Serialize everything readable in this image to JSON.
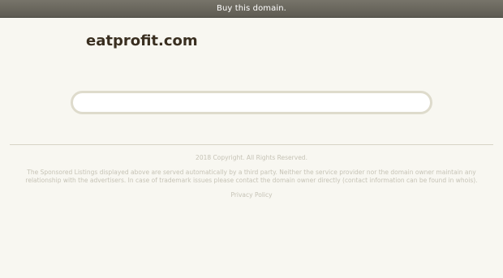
{
  "topbar": {
    "buy_label": "Buy this domain."
  },
  "header": {
    "domain": "eatprofit.com"
  },
  "search": {
    "value": "",
    "placeholder": ""
  },
  "footer": {
    "copyright": "2018 Copyright. All Rights Reserved.",
    "disclaimer": "The Sponsored Listings displayed above are served automatically by a third party. Neither the service provider nor the domain owner maintain any relationship with the advertisers. In case of trademark issues please contact the domain owner directly (contact information can be found in whois).",
    "privacy_label": "Privacy Policy"
  },
  "colors": {
    "background": "#f8f7f1",
    "topbar": "#6b685f",
    "title": "#3a2f20",
    "footer_text": "#c6c3b6"
  }
}
